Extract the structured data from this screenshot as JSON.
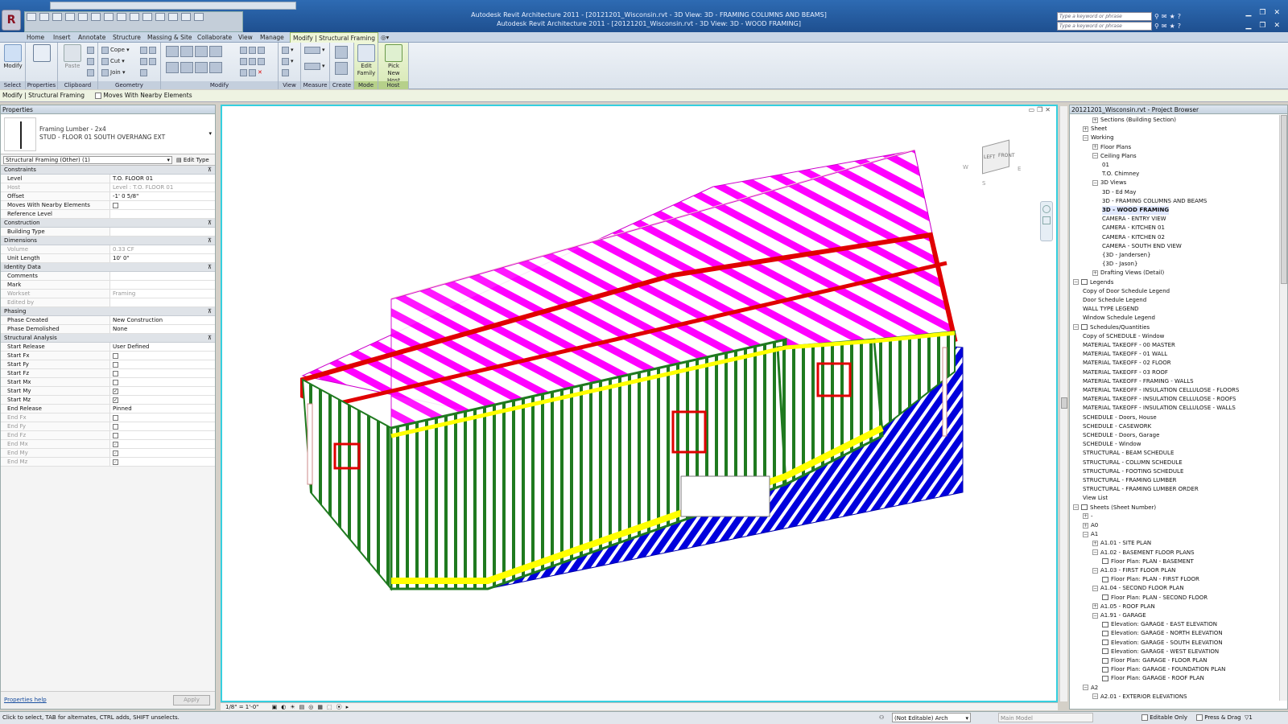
{
  "titlebar": {
    "doc_title_behind": "Autodesk Revit Architecture 2011 - [20121201_Wisconsin.rvt - 3D View: 3D - FRAMING COLUMNS AND BEAMS]",
    "doc_title_active": "Autodesk Revit Architecture 2011 - [20121201_Wisconsin.rvt - 3D View: 3D - WOOD FRAMING]",
    "search_placeholder": "Type a keyword or phrase",
    "app_button": "R"
  },
  "tabs": [
    "Home",
    "Insert",
    "Annotate",
    "Structure",
    "Massing & Site",
    "Collaborate",
    "View",
    "Manage",
    "Modify | Structural Framing"
  ],
  "ribbon": {
    "modify_label": "Modify",
    "select_label": "Select",
    "properties_label": "Properties",
    "paste_label": "Paste",
    "clipboard_label": "Clipboard",
    "cope_label": "Cope",
    "cut_label": "Cut",
    "join_label": "Join",
    "geometry_label": "Geometry",
    "modify_panel_label": "Modify",
    "view_label": "View",
    "measure_label": "Measure",
    "create_label": "Create",
    "edit_family_label": "Edit Family",
    "mode_label": "Mode",
    "pick_new_host_label": "Pick New Host",
    "host_label": "Host"
  },
  "optionsbar": {
    "context": "Modify | Structural Framing",
    "moves_with": "Moves With Nearby Elements"
  },
  "properties": {
    "title": "Properties",
    "type_family": "Framing Lumber - 2x4",
    "type_name": "STUD - FLOOR 01 SOUTH OVERHANG EXT",
    "selector": "Structural Framing (Other) (1)",
    "edit_type": "Edit Type",
    "sections": [
      {
        "name": "Constraints",
        "rows": [
          {
            "k": "Level",
            "v": "T.O. FLOOR 01"
          },
          {
            "k": "Host",
            "v": "Level : T.O. FLOOR 01",
            "dim": true
          },
          {
            "k": "Offset",
            "v": "-1' 0 5/8\""
          },
          {
            "k": "Moves With Nearby Elements",
            "v": "",
            "chk": true
          },
          {
            "k": "Reference Level",
            "v": ""
          }
        ]
      },
      {
        "name": "Construction",
        "rows": [
          {
            "k": "Building Type",
            "v": ""
          }
        ]
      },
      {
        "name": "Dimensions",
        "rows": [
          {
            "k": "Volume",
            "v": "0.33 CF",
            "dim": true
          },
          {
            "k": "Unit Length",
            "v": "10' 0\""
          }
        ]
      },
      {
        "name": "Identity Data",
        "rows": [
          {
            "k": "Comments",
            "v": ""
          },
          {
            "k": "Mark",
            "v": ""
          },
          {
            "k": "Workset",
            "v": "Framing",
            "dim": true
          },
          {
            "k": "Edited by",
            "v": "",
            "dim": true
          }
        ]
      },
      {
        "name": "Phasing",
        "rows": [
          {
            "k": "Phase Created",
            "v": "New Construction"
          },
          {
            "k": "Phase Demolished",
            "v": "None"
          }
        ]
      },
      {
        "name": "Structural Analysis",
        "rows": [
          {
            "k": "Start Release",
            "v": "User Defined"
          },
          {
            "k": "Start Fx",
            "v": "",
            "chk": true
          },
          {
            "k": "Start Fy",
            "v": "",
            "chk": true
          },
          {
            "k": "Start Fz",
            "v": "",
            "chk": true
          },
          {
            "k": "Start Mx",
            "v": "",
            "chk": true
          },
          {
            "k": "Start My",
            "v": "✓",
            "chk": true
          },
          {
            "k": "Start Mz",
            "v": "✓",
            "chk": true
          },
          {
            "k": "End Release",
            "v": "Pinned"
          },
          {
            "k": "End Fx",
            "v": "",
            "chk": true,
            "dim": true
          },
          {
            "k": "End Fy",
            "v": "",
            "chk": true,
            "dim": true
          },
          {
            "k": "End Fz",
            "v": "",
            "chk": true,
            "dim": true
          },
          {
            "k": "End Mx",
            "v": "✓",
            "chk": true,
            "dim": true
          },
          {
            "k": "End My",
            "v": "✓",
            "chk": true,
            "dim": true
          },
          {
            "k": "End Mz",
            "v": "✓",
            "chk": true,
            "dim": true
          }
        ]
      }
    ],
    "help_link": "Properties help",
    "apply": "Apply"
  },
  "viewcube": {
    "left": "LEFT",
    "front": "FRONT",
    "w": "W",
    "s": "S",
    "e": "E"
  },
  "view_controls": {
    "scale": "1/8\" = 1'-0\""
  },
  "browser": {
    "title": "20121201_Wisconsin.rvt - Project Browser",
    "items": [
      {
        "t": "Sections (Building Section)",
        "l": 2,
        "g": "+"
      },
      {
        "t": "Sheet",
        "l": 1,
        "g": "+"
      },
      {
        "t": "Working",
        "l": 1,
        "g": "−"
      },
      {
        "t": "Floor Plans",
        "l": 2,
        "g": "+"
      },
      {
        "t": "Ceiling Plans",
        "l": 2,
        "g": "−"
      },
      {
        "t": "01",
        "l": 3
      },
      {
        "t": "T.O. Chimney",
        "l": 3
      },
      {
        "t": "3D Views",
        "l": 2,
        "g": "−"
      },
      {
        "t": "3D - Ed May",
        "l": 3
      },
      {
        "t": "3D - FRAMING COLUMNS AND BEAMS",
        "l": 3
      },
      {
        "t": "3D - WOOD FRAMING",
        "l": 3,
        "sel": true
      },
      {
        "t": "CAMERA - ENTRY VIEW",
        "l": 3
      },
      {
        "t": "CAMERA - KITCHEN 01",
        "l": 3
      },
      {
        "t": "CAMERA - KITCHEN 02",
        "l": 3
      },
      {
        "t": "CAMERA - SOUTH END VIEW",
        "l": 3
      },
      {
        "t": "{3D - Jandersen}",
        "l": 3
      },
      {
        "t": "{3D - Jason}",
        "l": 3
      },
      {
        "t": "Drafting Views (Detail)",
        "l": 2,
        "g": "+"
      },
      {
        "t": "Legends",
        "l": 0,
        "g": "−",
        "f": true
      },
      {
        "t": "Copy of Door Schedule Legend",
        "l": 1
      },
      {
        "t": "Door Schedule Legend",
        "l": 1
      },
      {
        "t": "WALL TYPE LEGEND",
        "l": 1
      },
      {
        "t": "Window Schedule Legend",
        "l": 1
      },
      {
        "t": "Schedules/Quantities",
        "l": 0,
        "g": "−",
        "f": true
      },
      {
        "t": "Copy of SCHEDULE - Window",
        "l": 1
      },
      {
        "t": "MATERIAL TAKEOFF - 00 MASTER",
        "l": 1
      },
      {
        "t": "MATERIAL TAKEOFF - 01 WALL",
        "l": 1
      },
      {
        "t": "MATERIAL TAKEOFF - 02 FLOOR",
        "l": 1
      },
      {
        "t": "MATERIAL TAKEOFF - 03 ROOF",
        "l": 1
      },
      {
        "t": "MATERIAL TAKEOFF - FRAMING - WALLS",
        "l": 1
      },
      {
        "t": "MATERIAL TAKEOFF - INSULATION CELLULOSE - FLOORS",
        "l": 1
      },
      {
        "t": "MATERIAL TAKEOFF - INSULATION CELLULOSE - ROOFS",
        "l": 1
      },
      {
        "t": "MATERIAL TAKEOFF - INSULATION CELLULOSE - WALLS",
        "l": 1
      },
      {
        "t": "SCHEDULE - Doors, House",
        "l": 1
      },
      {
        "t": "SCHEDULE - CASEWORK",
        "l": 1
      },
      {
        "t": "SCHEDULE - Doors, Garage",
        "l": 1
      },
      {
        "t": "SCHEDULE - Window",
        "l": 1
      },
      {
        "t": "STRUCTURAL - BEAM SCHEDULE",
        "l": 1
      },
      {
        "t": "STRUCTURAL - COLUMN SCHEDULE",
        "l": 1
      },
      {
        "t": "STRUCTURAL - FOOTING SCHEDULE",
        "l": 1
      },
      {
        "t": "STRUCTURAL - FRAMING LUMBER",
        "l": 1
      },
      {
        "t": "STRUCTURAL - FRAMING LUMBER ORDER",
        "l": 1
      },
      {
        "t": "View List",
        "l": 1
      },
      {
        "t": "Sheets (Sheet Number)",
        "l": 0,
        "g": "−",
        "f": true
      },
      {
        "t": "-",
        "l": 1,
        "g": "+"
      },
      {
        "t": "A0",
        "l": 1,
        "g": "+"
      },
      {
        "t": "A1",
        "l": 1,
        "g": "−"
      },
      {
        "t": "A1.01 - SITE PLAN",
        "l": 2,
        "g": "+"
      },
      {
        "t": "A1.02 - BASEMENT FLOOR PLANS",
        "l": 2,
        "g": "−"
      },
      {
        "t": "Floor Plan: PLAN - BASEMENT",
        "l": 3,
        "f": true
      },
      {
        "t": "A1.03 - FIRST FLOOR PLAN",
        "l": 2,
        "g": "−"
      },
      {
        "t": "Floor Plan: PLAN - FIRST FLOOR",
        "l": 3,
        "f": true
      },
      {
        "t": "A1.04 - SECOND FLOOR PLAN",
        "l": 2,
        "g": "−"
      },
      {
        "t": "Floor Plan: PLAN - SECOND FLOOR",
        "l": 3,
        "f": true
      },
      {
        "t": "A1.05 - ROOF PLAN",
        "l": 2,
        "g": "+"
      },
      {
        "t": "A1.91 - GARAGE",
        "l": 2,
        "g": "−"
      },
      {
        "t": "Elevation: GARAGE - EAST ELEVATION",
        "l": 3,
        "f": true
      },
      {
        "t": "Elevation: GARAGE - NORTH ELEVATION",
        "l": 3,
        "f": true
      },
      {
        "t": "Elevation: GARAGE - SOUTH ELEVATION",
        "l": 3,
        "f": true
      },
      {
        "t": "Elevation: GARAGE - WEST ELEVATION",
        "l": 3,
        "f": true
      },
      {
        "t": "Floor Plan: GARAGE - FLOOR PLAN",
        "l": 3,
        "f": true
      },
      {
        "t": "Floor Plan: GARAGE - FOUNDATION PLAN",
        "l": 3,
        "f": true
      },
      {
        "t": "Floor Plan: GARAGE - ROOF PLAN",
        "l": 3,
        "f": true
      },
      {
        "t": "A2",
        "l": 1,
        "g": "−"
      },
      {
        "t": "A2.01 - EXTERIOR ELEVATIONS",
        "l": 2,
        "g": "−"
      }
    ]
  },
  "status": {
    "hint": "Click to select, TAB for alternates, CTRL adds, SHIFT unselects.",
    "workset": "(Not Editable) Arch",
    "model": "Main Model",
    "editable_only": "Editable Only",
    "press_drag": "Press & Drag",
    "filter_count": "1"
  },
  "colors": {
    "rafters": "#ff00ff",
    "joists": "#0000dd",
    "walls": "#1f7a1f",
    "headers": "#e00000",
    "plates": "#ffff00",
    "accent": "#35d0e0"
  }
}
